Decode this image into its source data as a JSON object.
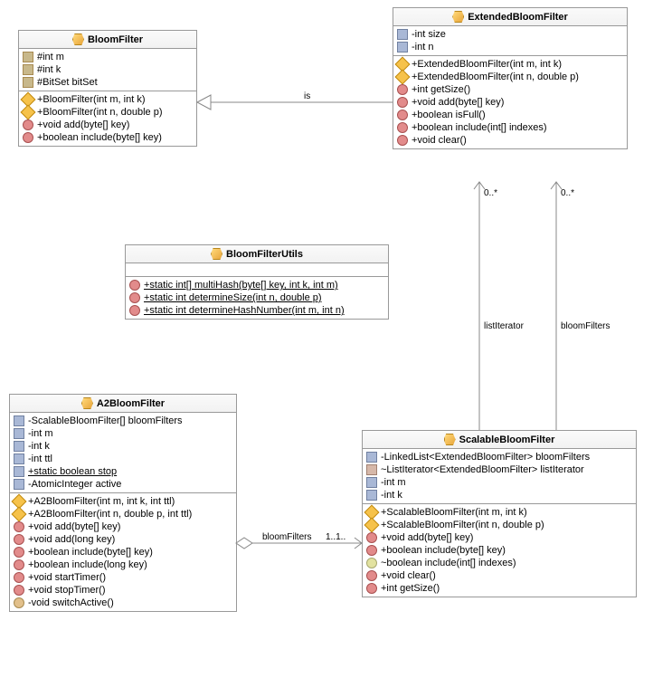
{
  "classes": {
    "bloomFilter": {
      "name": "BloomFilter",
      "fields": [
        {
          "icon": "field-protected",
          "text": "#int m"
        },
        {
          "icon": "field-protected",
          "text": "#int k"
        },
        {
          "icon": "field-protected",
          "text": "#BitSet bitSet"
        }
      ],
      "methods": [
        {
          "icon": "constructor",
          "text": "+BloomFilter(int m, int k)"
        },
        {
          "icon": "constructor",
          "text": "+BloomFilter(int n, double p)"
        },
        {
          "icon": "method-public",
          "text": "+void add(byte[] key)"
        },
        {
          "icon": "method-public",
          "text": "+boolean include(byte[] key)"
        }
      ]
    },
    "extendedBloomFilter": {
      "name": "ExtendedBloomFilter",
      "fields": [
        {
          "icon": "field-private",
          "text": "-int size"
        },
        {
          "icon": "field-private",
          "text": "-int n"
        }
      ],
      "methods": [
        {
          "icon": "constructor",
          "text": "+ExtendedBloomFilter(int m, int k)"
        },
        {
          "icon": "constructor",
          "text": "+ExtendedBloomFilter(int n, double p)"
        },
        {
          "icon": "method-public",
          "text": "+int getSize()"
        },
        {
          "icon": "method-public",
          "text": "+void add(byte[] key)"
        },
        {
          "icon": "method-public",
          "text": "+boolean isFull()"
        },
        {
          "icon": "method-public",
          "text": "+boolean include(int[] indexes)"
        },
        {
          "icon": "method-public",
          "text": "+void clear()"
        }
      ]
    },
    "bloomFilterUtils": {
      "name": "BloomFilterUtils",
      "fields": [],
      "methods": [
        {
          "icon": "method-public",
          "text": "+static int[] multiHash(byte[] key, int k, int m)",
          "underline": true
        },
        {
          "icon": "method-public",
          "text": "+static int determineSize(int n, double p)",
          "underline": true
        },
        {
          "icon": "method-public",
          "text": "+static int determineHashNumber(int m, int n)",
          "underline": true
        }
      ]
    },
    "a2BloomFilter": {
      "name": "A2BloomFilter",
      "fields": [
        {
          "icon": "field-private",
          "text": "-ScalableBloomFilter[] bloomFilters"
        },
        {
          "icon": "field-private",
          "text": "-int m"
        },
        {
          "icon": "field-private",
          "text": "-int k"
        },
        {
          "icon": "field-private",
          "text": "-int ttl"
        },
        {
          "icon": "field-private",
          "text": "+static boolean stop",
          "underline": true
        },
        {
          "icon": "field-private",
          "text": "-AtomicInteger active"
        }
      ],
      "methods": [
        {
          "icon": "constructor",
          "text": "+A2BloomFilter(int m, int k, int ttl)"
        },
        {
          "icon": "constructor",
          "text": "+A2BloomFilter(int n, double p, int ttl)"
        },
        {
          "icon": "method-public",
          "text": "+void add(byte[] key)"
        },
        {
          "icon": "method-public",
          "text": "+void add(long key)"
        },
        {
          "icon": "method-public",
          "text": "+boolean include(byte[] key)"
        },
        {
          "icon": "method-public",
          "text": "+boolean include(long key)"
        },
        {
          "icon": "method-public",
          "text": "+void startTimer()"
        },
        {
          "icon": "method-public",
          "text": "+void stopTimer()"
        },
        {
          "icon": "method-protected",
          "text": "-void switchActive()"
        }
      ]
    },
    "scalableBloomFilter": {
      "name": "ScalableBloomFilter",
      "fields": [
        {
          "icon": "field-private",
          "text": "-LinkedList<ExtendedBloomFilter> bloomFilters"
        },
        {
          "icon": "field-package",
          "text": "~ListIterator<ExtendedBloomFilter> listIterator"
        },
        {
          "icon": "field-private",
          "text": "-int m"
        },
        {
          "icon": "field-private",
          "text": "-int k"
        }
      ],
      "methods": [
        {
          "icon": "constructor",
          "text": "+ScalableBloomFilter(int m, int k)"
        },
        {
          "icon": "constructor",
          "text": "+ScalableBloomFilter(int n, double p)"
        },
        {
          "icon": "method-public",
          "text": "+void add(byte[] key)"
        },
        {
          "icon": "method-public",
          "text": "+boolean include(byte[] key)"
        },
        {
          "icon": "method-package",
          "text": "~boolean include(int[] indexes)"
        },
        {
          "icon": "method-public",
          "text": "+void clear()"
        },
        {
          "icon": "method-public",
          "text": "+int getSize()"
        }
      ]
    }
  },
  "relations": {
    "is": {
      "label": "is"
    },
    "listIterator": {
      "label": "listIterator",
      "multiplicity": "0..*"
    },
    "bloomFiltersUp": {
      "label": "bloomFilters",
      "multiplicity": "0..*"
    },
    "bloomFiltersHoriz": {
      "label": "bloomFilters",
      "multiplicity": "1..1.. "
    }
  }
}
